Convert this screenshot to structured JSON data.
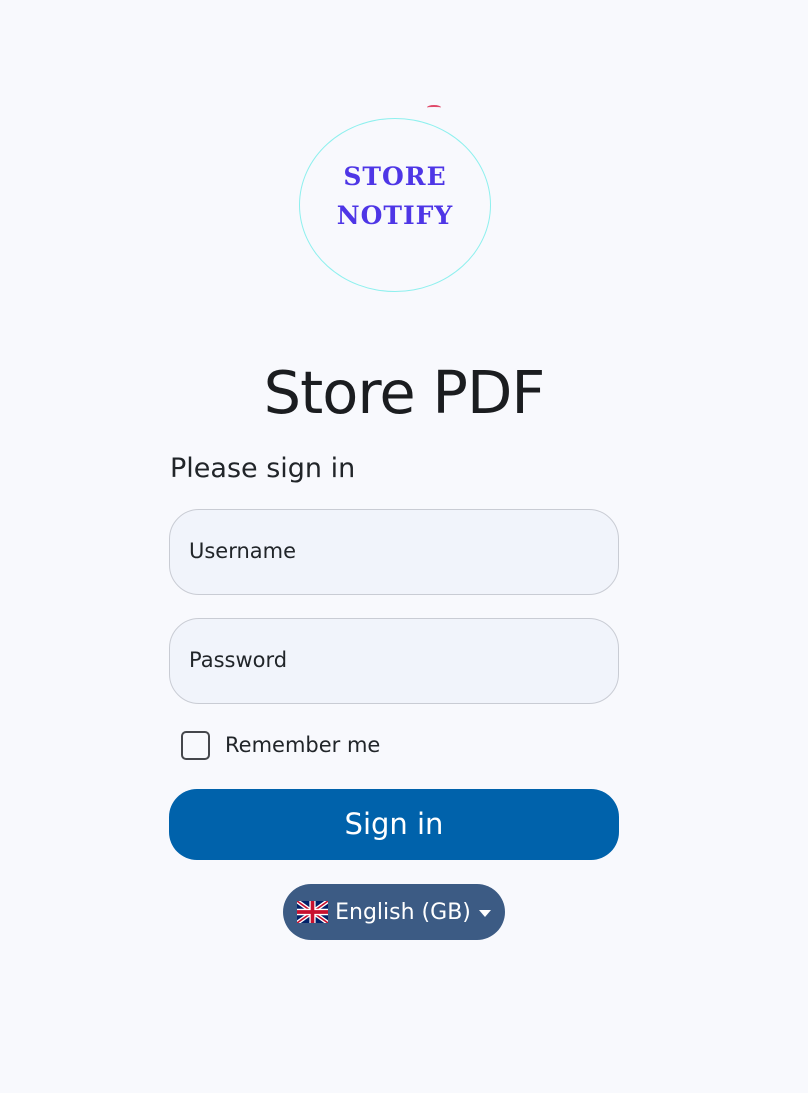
{
  "logo": {
    "line1": "STORE",
    "line2": "NOTIFY",
    "text_color": "#4e36e6",
    "ring_color": "#8ef0ee"
  },
  "app_title": "Store PDF",
  "signin_heading": "Please sign in",
  "form": {
    "username_label": "Username",
    "password_label": "Password",
    "remember_label": "Remember me",
    "remember_checked": false,
    "submit_label": "Sign in"
  },
  "language": {
    "selected": "English (GB)",
    "icon": "uk-flag-icon"
  },
  "colors": {
    "primary": "#0062ab",
    "language_button": "#3c5b84",
    "background": "#f8f9fd",
    "input_background": "#f1f4fb"
  }
}
